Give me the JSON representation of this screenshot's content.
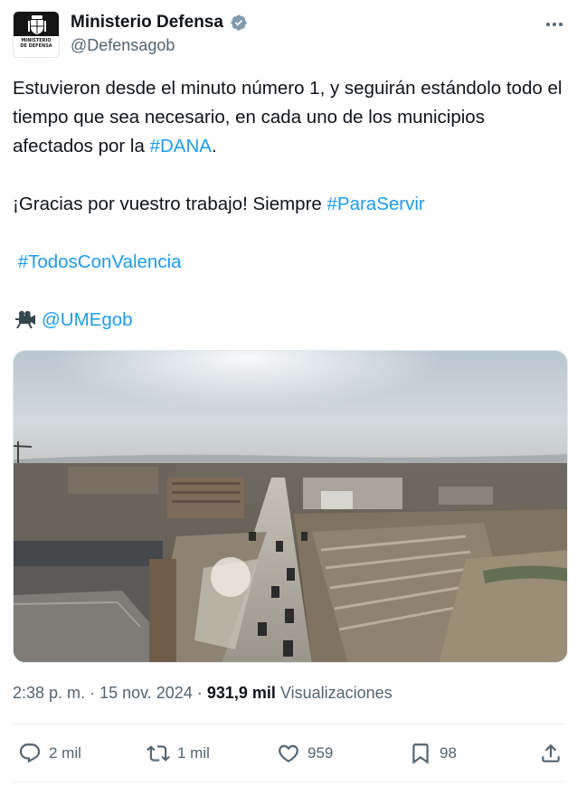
{
  "account": {
    "display_name": "Ministerio Defensa",
    "handle": "@Defensagob",
    "avatar_caption_line1": "MINISTERIO",
    "avatar_caption_line2": "DE DEFENSA"
  },
  "tweet": {
    "line1": "Estuvieron desde el minuto número 1, y seguirán estándolo todo el tiempo que sea necesario, en cada uno de los municipios afectados por la ",
    "hashtag_dana": "#DANA",
    "line1_end": ".",
    "line2": "¡Gracias por vuestro trabajo! Siempre ",
    "hashtag_paraservir": "#ParaServir",
    "hashtag_todosconvalencia": "#TodosConValencia",
    "mention": "@UMEgob"
  },
  "meta": {
    "time": "2:38 p. m.",
    "separator": "·",
    "date": "15 nov. 2024",
    "views_count": "931,9 mil",
    "views_label": "Visualizaciones"
  },
  "actions": {
    "replies": "2 mil",
    "reposts": "1 mil",
    "likes": "959",
    "bookmarks": "98"
  },
  "icons": {
    "verified": "verified-badge-icon",
    "more": "more-options-icon",
    "camera": "video-camera-icon",
    "reply": "reply-icon",
    "repost": "repost-icon",
    "like": "heart-icon",
    "bookmark": "bookmark-icon",
    "share": "share-icon"
  },
  "colors": {
    "link": "#1d9bf0",
    "secondary_text": "#536471",
    "primary_text": "#0f1419",
    "verified_badge": "#829aab"
  }
}
